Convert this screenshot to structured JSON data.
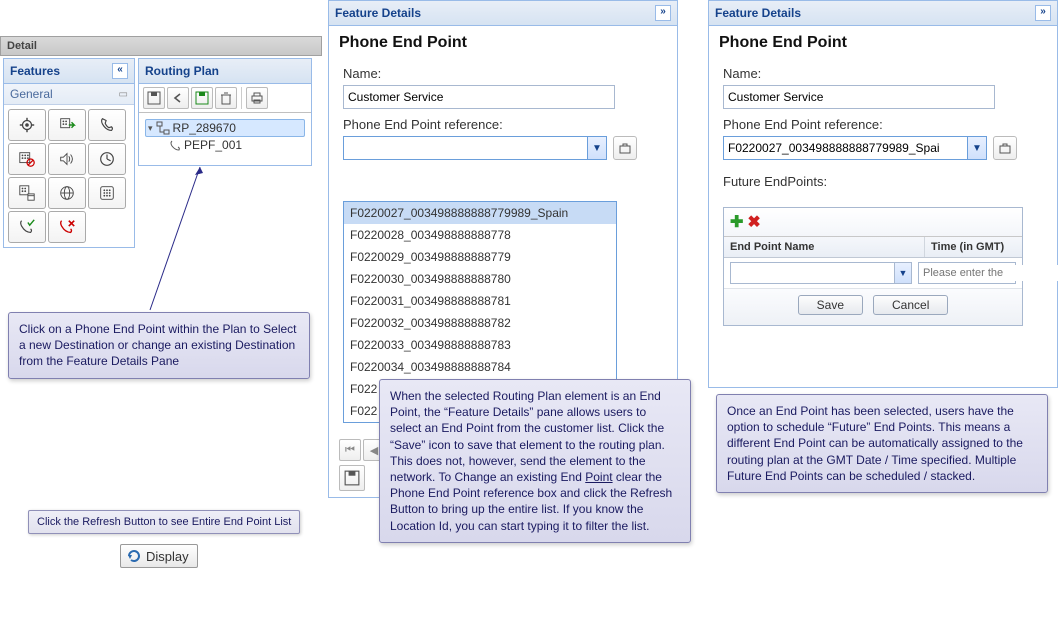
{
  "left": {
    "detail_bar": "Detail",
    "features_panel_title": "Features",
    "features_tab": "General",
    "routing_panel_title": "Routing Plan",
    "tree": {
      "root": "RP_289670",
      "child": "PEPF_001"
    },
    "callout1": "Click on a Phone End Point within the Plan to Select a new Destination or change an existing Destination from the Feature Details Pane",
    "callout2": "Click the Refresh Button to see Entire End Point List",
    "display_button": "Display"
  },
  "middle": {
    "panel_title": "Feature Details",
    "heading": "Phone End Point",
    "name_label": "Name:",
    "name_value": "Customer Service",
    "ref_label": "Phone End Point reference:",
    "ref_value": "",
    "options": [
      "F0220027_003498888888779989_Spain",
      "F0220028_003498888888778",
      "F0220029_003498888888779",
      "F0220030_003498888888780",
      "F0220031_003498888888781",
      "F0220032_003498888888782",
      "F0220033_003498888888783",
      "F0220034_003498888888784",
      "F022",
      "F022"
    ],
    "callout_part1": "When the selected Routing Plan element is an End Point, the “Feature Details” pane allows users to select an End Point from the customer list. Click the “Save” icon to save that element to the routing plan. This does not, however, send the element to the network. To Change an existing End ",
    "callout_link": "Point",
    "callout_part2": " clear the Phone End Point reference box and click the Refresh Button to bring up the entire list. If you know the Location Id, you can start typing it to filter the list."
  },
  "right": {
    "panel_title": "Feature Details",
    "heading": "Phone End Point",
    "name_label": "Name:",
    "name_value": "Customer Service",
    "ref_label": "Phone End Point reference:",
    "ref_value": "F0220027_003498888888779989_Spai",
    "future_label": "Future EndPoints:",
    "col1": "End Point Name",
    "col2": "Time (in GMT)",
    "row_endpoint": "",
    "row_time_placeholder": "Please enter the",
    "save_btn": "Save",
    "cancel_btn": "Cancel",
    "callout": "Once an End Point has been selected, users have the option to schedule “Future” End Points. This means a different End Point can be automatically assigned to the routing plan at the GMT Date / Time specified. Multiple Future End Points can be scheduled / stacked."
  }
}
